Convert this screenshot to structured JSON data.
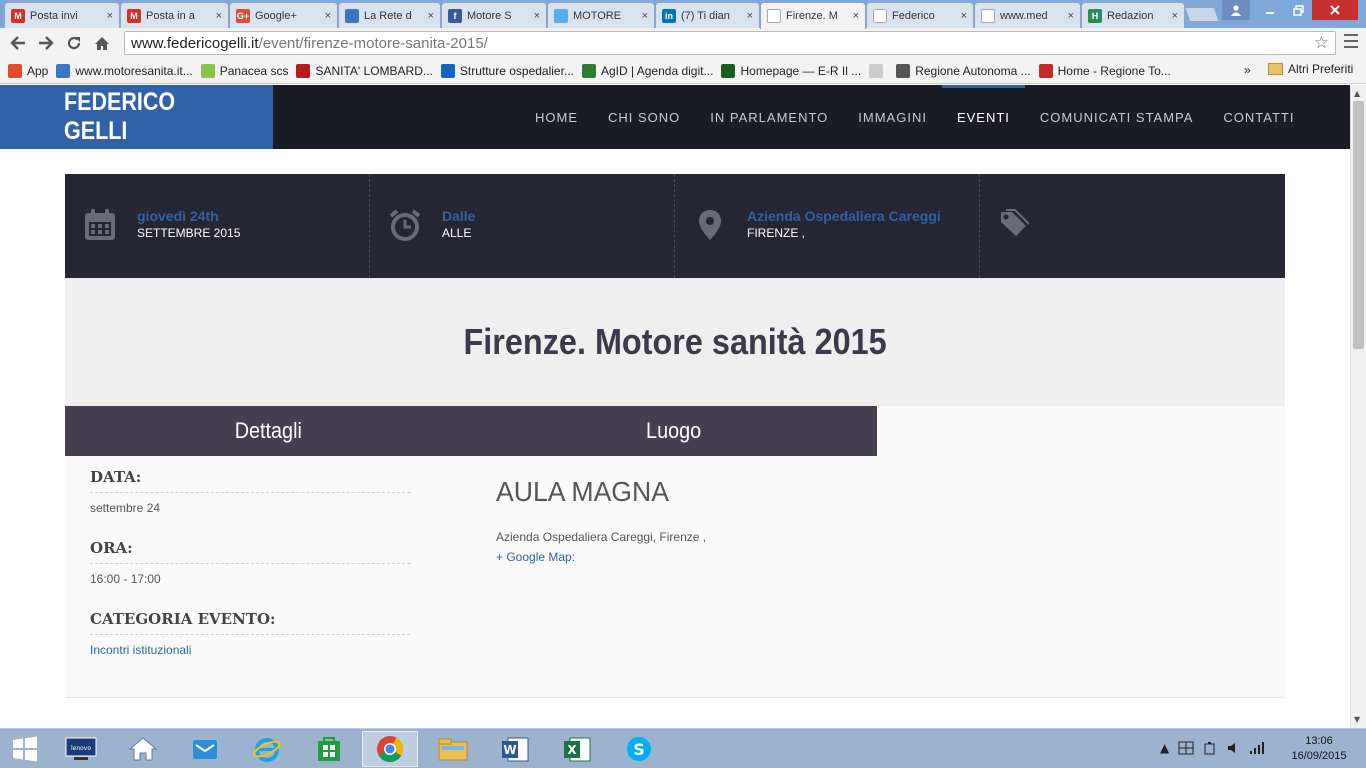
{
  "browser": {
    "tabs": [
      {
        "title": "Posta invi",
        "icon": "gmail-icon",
        "color": "#d93025",
        "letter": "M"
      },
      {
        "title": "Posta in a",
        "icon": "gmail-icon",
        "color": "#d93025",
        "letter": "M"
      },
      {
        "title": "Google+",
        "icon": "google-plus-icon",
        "color": "#dd4b39",
        "letter": "G+"
      },
      {
        "title": "La Rete d",
        "icon": "loading-icon",
        "color": "#3b78c4",
        "letter": ""
      },
      {
        "title": "Motore S",
        "icon": "facebook-icon",
        "color": "#3b5998",
        "letter": "f"
      },
      {
        "title": "MOTORE",
        "icon": "twitter-icon",
        "color": "#55acee",
        "letter": ""
      },
      {
        "title": "(7) Ti dian",
        "icon": "linkedin-icon",
        "color": "#0077b5",
        "letter": "in"
      },
      {
        "title": "Firenze. M",
        "icon": "page-icon",
        "color": "",
        "letter": "",
        "active": true
      },
      {
        "title": "Federico",
        "icon": "page-icon",
        "color": "",
        "letter": ""
      },
      {
        "title": "www.med",
        "icon": "document-icon",
        "color": "",
        "letter": ""
      },
      {
        "title": "Redazion",
        "icon": "h-icon",
        "color": "#2e8b57",
        "letter": "H"
      }
    ],
    "close_glyph": "×",
    "url_host": "www.federicogelli.it",
    "url_path": "/event/firenze-motore-sanita-2015/",
    "bookmarks": [
      {
        "label": "App",
        "color": "#e34c26"
      },
      {
        "label": "www.motoresanita.it...",
        "color": "#3b78c4"
      },
      {
        "label": "Panacea scs",
        "color": "#8bc34a"
      },
      {
        "label": "SANITA' LOMBARD...",
        "color": "#b71c1c"
      },
      {
        "label": "Strutture ospedalier...",
        "color": "#1565c0"
      },
      {
        "label": "AgID | Agenda digit...",
        "color": "#2e7d32"
      },
      {
        "label": "Homepage — E-R Il ...",
        "color": "#1b5e20"
      },
      {
        "label": "",
        "color": "#cccccc"
      },
      {
        "label": "Regione Autonoma ...",
        "color": "#555555"
      },
      {
        "label": "Home - Regione To...",
        "color": "#c62828"
      }
    ],
    "bookmarks_more": "»",
    "other_bookmarks": "Altri Preferiti"
  },
  "site": {
    "logo": "FEDERICO GELLI",
    "nav": [
      {
        "label": "HOME",
        "active": false
      },
      {
        "label": "CHI SONO",
        "active": false
      },
      {
        "label": "IN PARLAMENTO",
        "active": false
      },
      {
        "label": "IMMAGINI",
        "active": false
      },
      {
        "label": "EVENTI",
        "active": true
      },
      {
        "label": "COMUNICATI STAMPA",
        "active": false
      },
      {
        "label": "CONTATTI",
        "active": false
      }
    ],
    "accent": "#2f62a6"
  },
  "event": {
    "info": [
      {
        "icon": "calendar-icon",
        "line1": "giovedì 24th",
        "line2": "SETTEMBRE 2015"
      },
      {
        "icon": "alarm-clock-icon",
        "line1": "Dalle",
        "line2": "ALLE"
      },
      {
        "icon": "map-pin-icon",
        "line1": "Azienda Ospedaliera Careggi",
        "line2": "FIRENZE ,"
      },
      {
        "icon": "tags-icon",
        "line1": "",
        "line2": ""
      }
    ],
    "title": "Firenze. Motore sanità 2015",
    "tabs": [
      "Dettagli",
      "Luogo"
    ],
    "details": {
      "date_label": "DATA:",
      "date_value": "settembre 24",
      "time_label": "ORA:",
      "time_value": "16:00 - 17:00",
      "category_label": "CATEGORIA EVENTO:",
      "category_value": "Incontri istituzionali"
    },
    "place": {
      "name": "AULA MAGNA",
      "address": "Azienda Ospedaliera Careggi, Firenze ,",
      "map_link": "+ Google Map:"
    }
  },
  "taskbar": {
    "time": "13:06",
    "date": "16/09/2015"
  }
}
